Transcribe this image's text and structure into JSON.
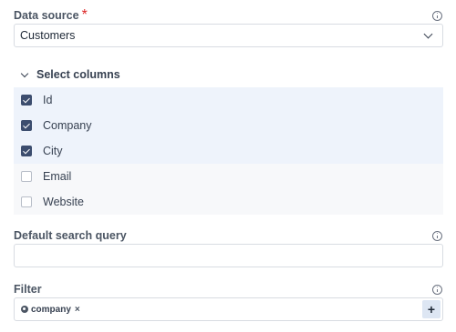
{
  "data_source": {
    "label": "Data source",
    "required_mark": "*",
    "value": "Customers"
  },
  "columns": {
    "title": "Select columns",
    "items": [
      {
        "label": "Id",
        "checked": true
      },
      {
        "label": "Company",
        "checked": true
      },
      {
        "label": "City",
        "checked": true
      },
      {
        "label": "Email",
        "checked": false
      },
      {
        "label": "Website",
        "checked": false
      }
    ]
  },
  "search_query": {
    "label": "Default search query",
    "value": ""
  },
  "filter": {
    "label": "Filter",
    "chip_label": "company",
    "chip_remove": "×",
    "add_label": "+"
  },
  "colors": {
    "accent": "#3c4d6e",
    "required": "#dc2626",
    "checked_row_bg": "#eef3fb",
    "add_button_bg": "#dde6f3"
  }
}
